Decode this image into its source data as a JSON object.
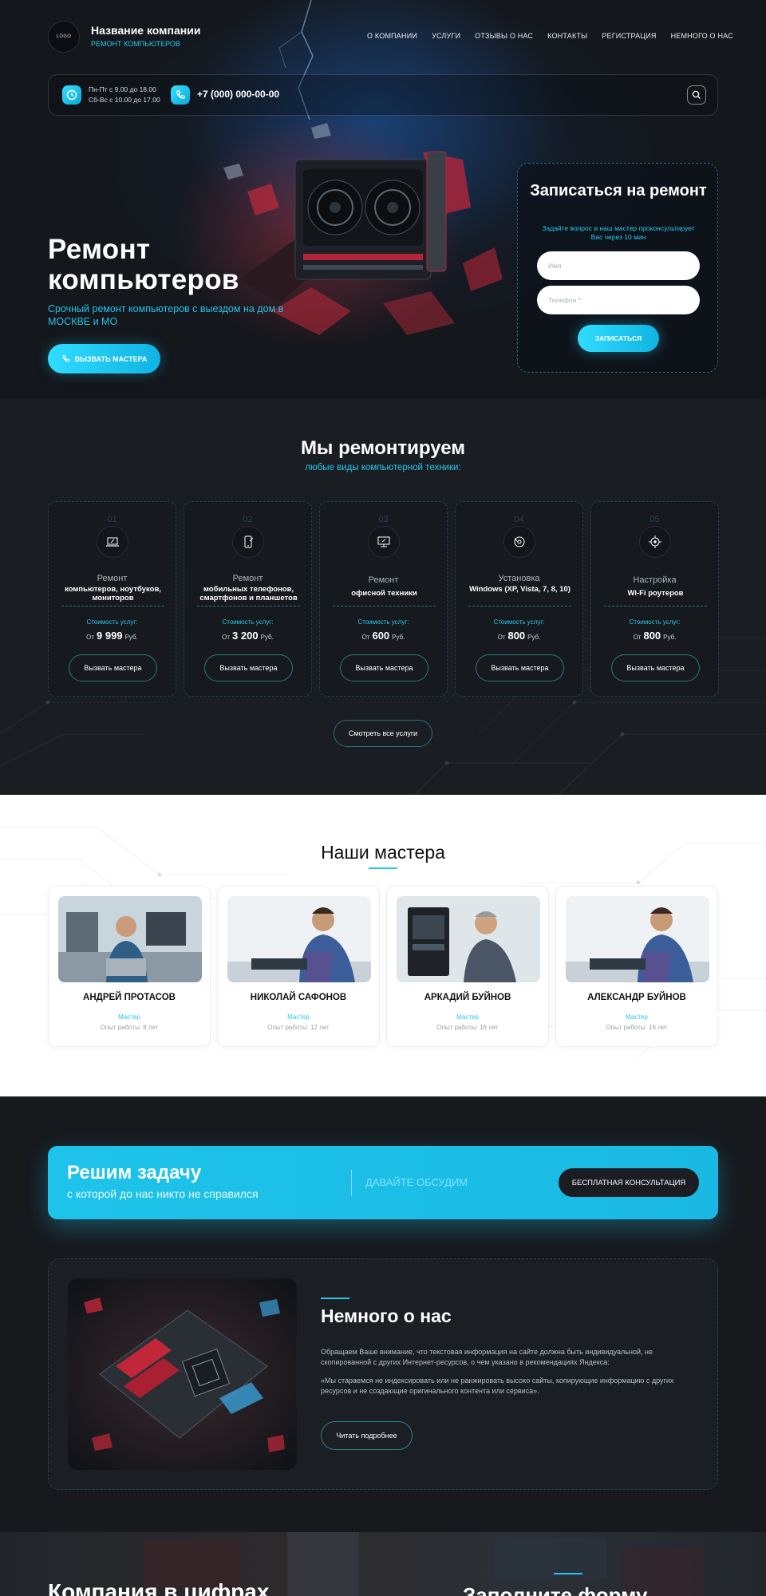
{
  "header": {
    "logo_text": "LOGO",
    "company_name": "Название компании",
    "company_subtitle": "РЕМОНТ КОМПЬЮТЕРОВ",
    "nav": [
      "О КОМПАНИИ",
      "УСЛУГИ",
      "ОТЗЫВЫ О НАС",
      "КОНТАКТЫ",
      "РЕГИСТРАЦИЯ",
      "НЕМНОГО О НАС"
    ]
  },
  "infobar": {
    "hours_line1": "Пн-Пт с 9.00 до 18.00",
    "hours_line2": "Сб-Вс с 10.00 до 17.00",
    "phone": "+7 (000) 000-00-00"
  },
  "hero": {
    "title_line1": "Ремонт",
    "title_line2": "компьютеров",
    "subtitle": "Срочный ремонт компьютеров с выездом на дом в МОСКВЕ и МО",
    "button": "ВЫЗВАТЬ МАСТЕРА"
  },
  "form": {
    "title": "Записаться на ремонт",
    "subtitle": "Задайте вопрос и наш мастер проконсультирует Вас через 10 мин",
    "name_placeholder": "Имя",
    "phone_placeholder": "Телефон *",
    "submit": "ЗАПИСАТЬСЯ"
  },
  "services": {
    "title": "Мы ремонтируем",
    "subtitle": "любые виды компьютерной техники:",
    "cost_label": "Стоимость услуг:",
    "price_prefix": "От",
    "price_suffix": "Руб.",
    "button": "Вызвать мастера",
    "all_button": "Смотреть все услуги",
    "items": [
      {
        "num": "01",
        "icon": "laptop-repair-icon",
        "line1": "Ремонт",
        "line2": "компьютеров, ноутбуков, мониторов",
        "price": "9 999"
      },
      {
        "num": "02",
        "icon": "phone-repair-icon",
        "line1": "Ремонт",
        "line2": "мобильных телефонов, смартфонов и планшетов",
        "price": "3 200"
      },
      {
        "num": "03",
        "icon": "monitor-repair-icon",
        "line1": "Ремонт",
        "line2": "офисной техники",
        "price": "600"
      },
      {
        "num": "04",
        "icon": "windows-install-icon",
        "line1": "Установка",
        "line2": "Windows (XP, Vista, 7, 8, 10)",
        "price": "800"
      },
      {
        "num": "05",
        "icon": "router-settings-icon",
        "line1": "Настройка",
        "line2": "Wi-Fi роутеров",
        "price": "800"
      }
    ]
  },
  "masters": {
    "title": "Наши мастера",
    "items": [
      {
        "name": "АНДРЕЙ ПРОТАСОВ",
        "role": "Мастер",
        "experience": "Опыт работы: 8 лет"
      },
      {
        "name": "НИКОЛАЙ САФОНОВ",
        "role": "Мастер",
        "experience": "Опыт работы: 12 лет"
      },
      {
        "name": "АРКАДИЙ БУЙНОВ",
        "role": "Мастер",
        "experience": "Опыт работы: 16 лет"
      },
      {
        "name": "АЛЕКСАНДР БУЙНОВ",
        "role": "Мастер",
        "experience": "Опыт работы: 16 лет"
      }
    ]
  },
  "cta": {
    "title": "Решим задачу",
    "subtitle": "с которой до нас никто не справился",
    "middle": "ДАВАЙТЕ ОБСУДИМ",
    "button": "БЕСПЛАТНАЯ КОНСУЛЬТАЦИЯ"
  },
  "about": {
    "title": "Немного о нас",
    "paragraph1": "Обращаем Ваше внимание, что текстовая информация на сайте должна быть индивидуальной, не скопированной с других Интернет-ресурсов, о чем указано в рекомендациях Яндекса:",
    "paragraph2": "«Мы стараемся не индексировать или не ранжировать высоко сайты, копирующие информацию с других ресурсов и не создающие оригинального контента или сервиса».",
    "button": "Читать подробнее"
  },
  "bottom": {
    "left_title": "Компания в цифрах",
    "right_title": "Заполните форму"
  },
  "colors": {
    "accent": "#27c8ec",
    "dark_bg": "#17191d",
    "card_bg": "#1b1e23"
  }
}
